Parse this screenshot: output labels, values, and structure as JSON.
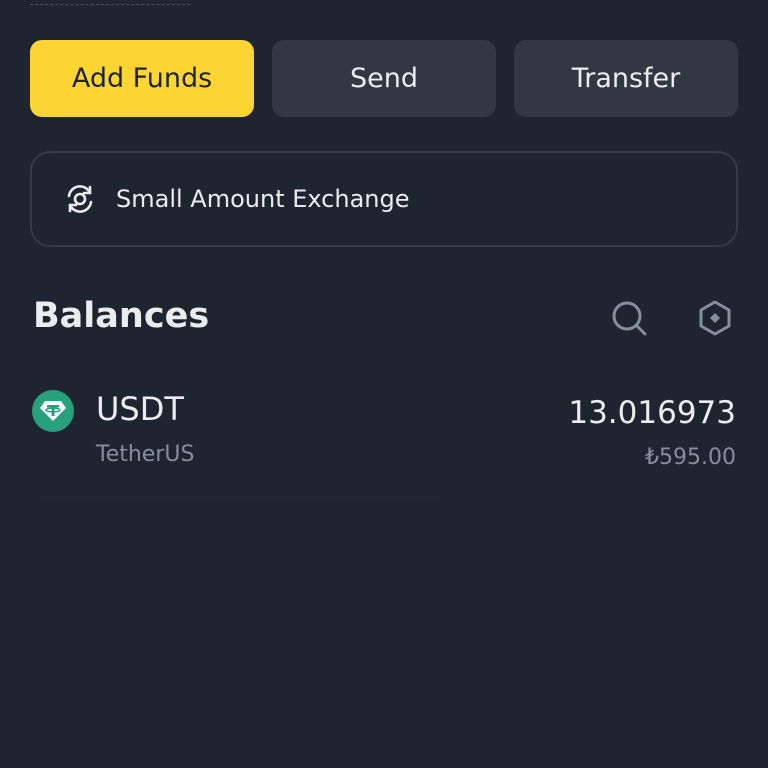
{
  "actions": {
    "add_funds": "Add Funds",
    "send": "Send",
    "transfer": "Transfer"
  },
  "exchange": {
    "label": "Small Amount Exchange",
    "icon": "exchange-refresh-icon"
  },
  "balances": {
    "title": "Balances",
    "search_icon": "search-icon",
    "settings_icon": "hexagon-settings-icon"
  },
  "assets": [
    {
      "symbol": "USDT",
      "name": "TetherUS",
      "amount": "13.016973",
      "fiat_value": "₺595.00",
      "logo_color": "#26a17b",
      "icon": "tether-logo-icon"
    }
  ],
  "colors": {
    "background": "#1f2530",
    "primary": "#fcd535",
    "secondary_button": "#313843",
    "muted_text": "#848e9c"
  }
}
